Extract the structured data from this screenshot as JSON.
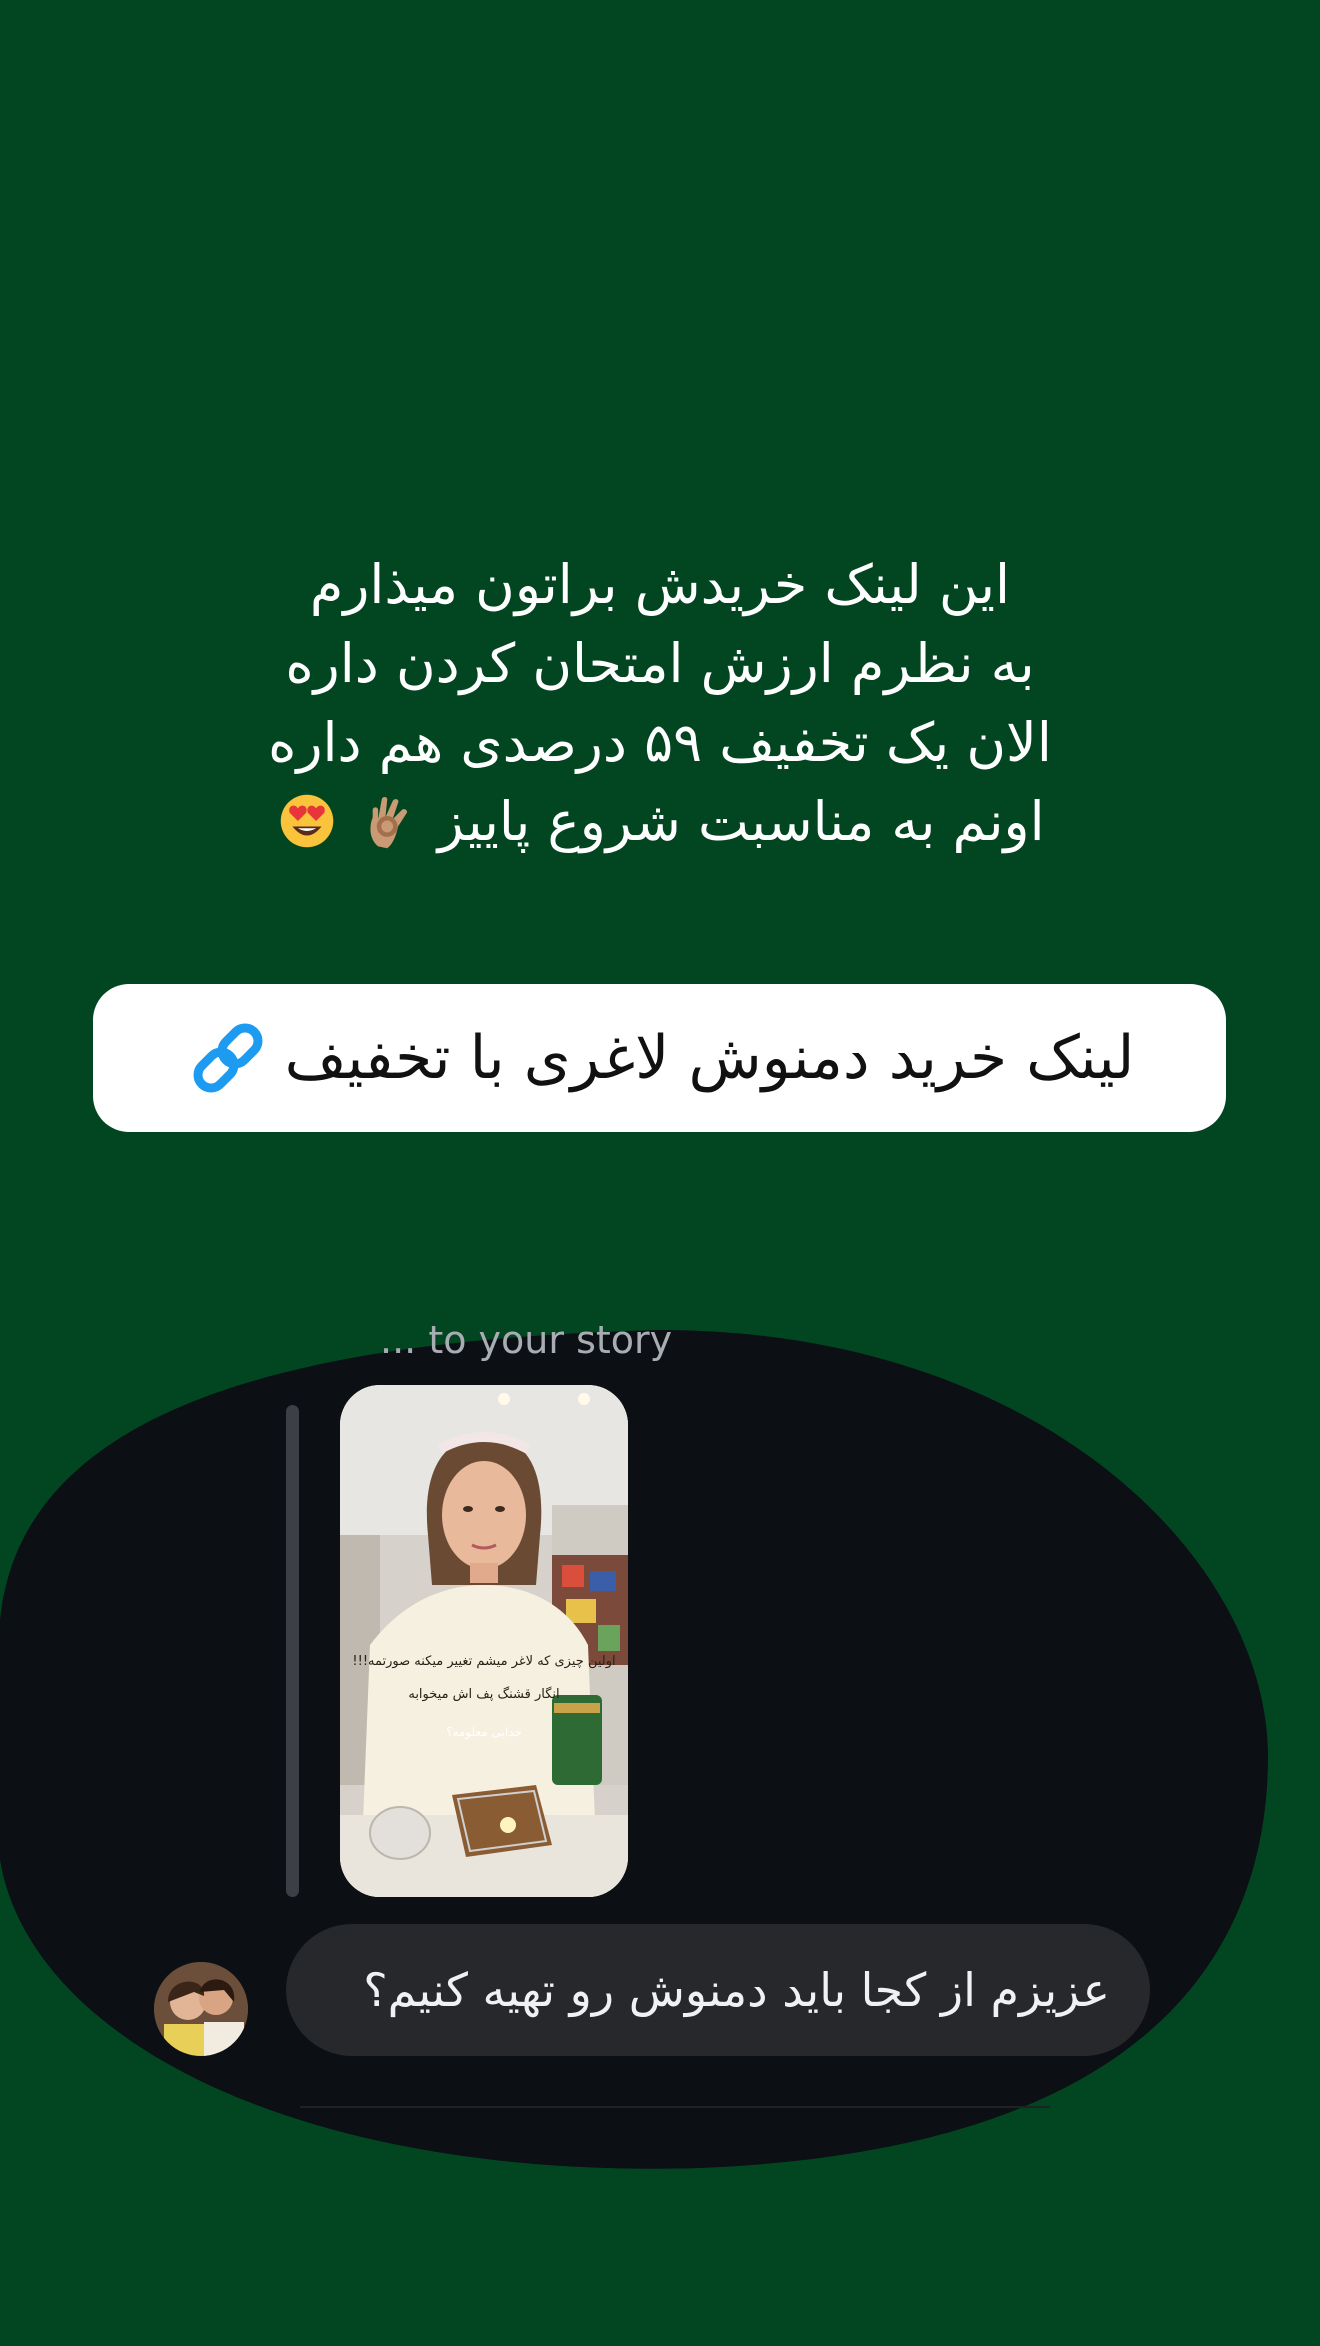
{
  "story": {
    "caption_lines": [
      "این لینک خریدش براتون میذارم",
      "به نظرم ارزش امتحان کردن داره",
      "الان یک تخفیف ۵۹  درصدی هم داره",
      "اونم به مناسبت شروع پاییز"
    ],
    "caption_emojis": [
      "ok-hand-emoji",
      "heart-eyes-emoji"
    ],
    "link_sticker": {
      "label": "لینک خرید دمنوش لاغری با تخفیف",
      "icon": "link-icon",
      "accent_color": "#1d9bf0"
    },
    "background_color": "#024621"
  },
  "dm_screenshot": {
    "replied_header": "... to your story",
    "story_preview": {
      "overlay_lines": [
        "اولین چیزی که لاغر میشم تغییر میکنه صورتمه!!!",
        "انگار قشنگ پف اش میخوابه"
      ],
      "overlay_small": "خدایی معلومه؟"
    },
    "message": {
      "text": "عزیزم از کجا باید دمنوش رو تهیه کنیم؟",
      "avatar": "user-avatar"
    },
    "background_color": "#0c0f14",
    "bubble_color": "#26282c"
  }
}
